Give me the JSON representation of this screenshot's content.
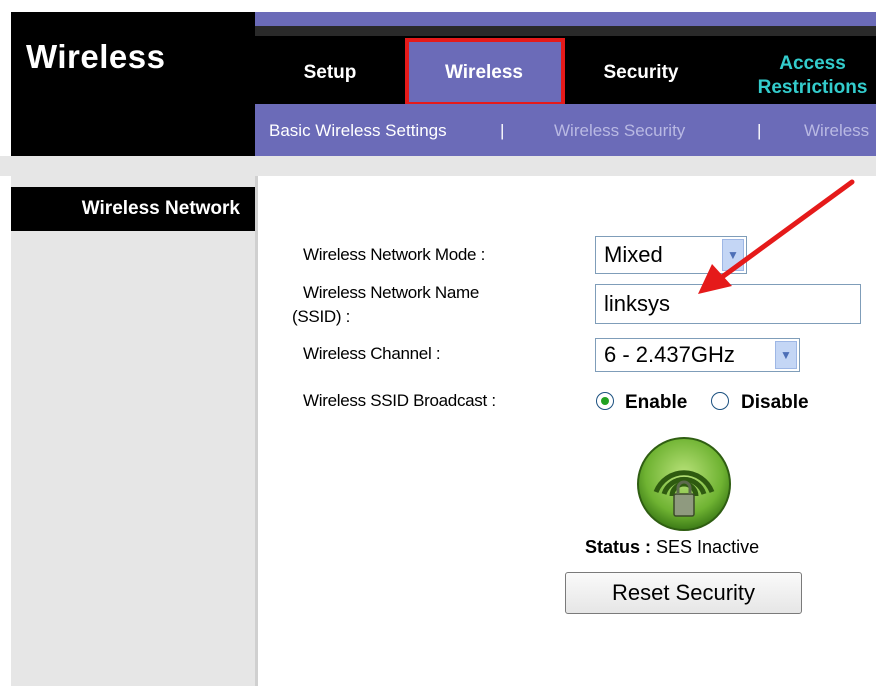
{
  "header": {
    "brand": "Wireless",
    "tabs": [
      "Setup",
      "Wireless",
      "Security",
      "Access",
      "Restrictions"
    ],
    "active_tab": "Wireless"
  },
  "subnav": {
    "basic": "Basic Wireless Settings",
    "separator": "|",
    "security": "Wireless Security",
    "wireless_partial": "Wireless"
  },
  "sidebar": {
    "section_title": "Wireless Network"
  },
  "form": {
    "mode_label": "Wireless Network Mode :",
    "mode_value": "Mixed",
    "ssid_label_line1": "Wireless Network Name",
    "ssid_label_line2": "(SSID) :",
    "ssid_value": "linksys",
    "channel_label": "Wireless Channel :",
    "channel_value": "6 - 2.437GHz",
    "broadcast_label": "Wireless SSID Broadcast :",
    "broadcast_enable": "Enable",
    "broadcast_disable": "Disable",
    "broadcast_selected": "Enable"
  },
  "ses": {
    "icon": "ses-wireless-lock-icon",
    "status_label": "Status :",
    "status_value": "SES Inactive",
    "reset_button": "Reset Security"
  },
  "colors": {
    "nav_purple": "#6b6bb8",
    "highlight_red": "#e51a1a",
    "access_cyan": "#33cccc",
    "ses_green": "#7cc23c"
  },
  "annotation": {
    "arrow_icon": "red-arrow-icon"
  }
}
